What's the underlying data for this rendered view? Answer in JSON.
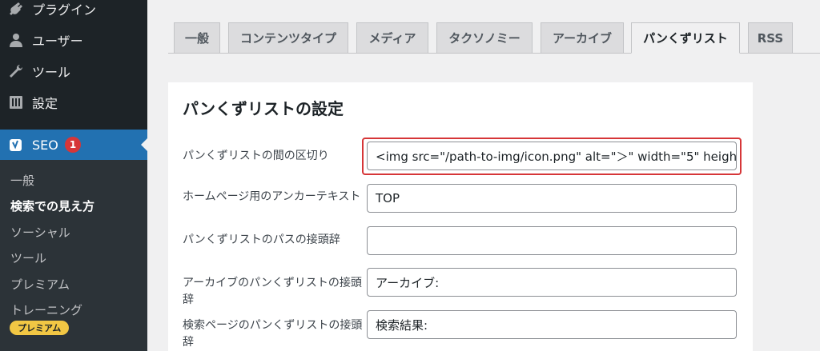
{
  "sidebar": {
    "menu": [
      {
        "label": "プラグイン",
        "icon": "plugin-icon"
      },
      {
        "label": "ユーザー",
        "icon": "user-icon"
      },
      {
        "label": "ツール",
        "icon": "wrench-icon"
      },
      {
        "label": "設定",
        "icon": "settings-icon"
      }
    ],
    "seo": {
      "label": "SEO",
      "icon": "yoast-icon",
      "badge": "1"
    },
    "submenu": [
      {
        "label": "一般"
      },
      {
        "label": "検索での見え方"
      },
      {
        "label": "ソーシャル"
      },
      {
        "label": "ツール"
      },
      {
        "label": "プレミアム"
      },
      {
        "label": "トレーニング"
      }
    ],
    "premium_pill": "プレミアム"
  },
  "tabs": [
    {
      "label": "一般"
    },
    {
      "label": "コンテンツタイプ"
    },
    {
      "label": "メディア"
    },
    {
      "label": "タクソノミー"
    },
    {
      "label": "アーカイブ"
    },
    {
      "label": "パンくずリスト"
    },
    {
      "label": "RSS"
    }
  ],
  "panel": {
    "title": "パンくずリストの設定",
    "fields": [
      {
        "label": "パンくずリストの間の区切り",
        "value": "<img src=\"/path-to-img/icon.png\" alt=\"＞\" width=\"5\" heigh"
      },
      {
        "label": "ホームページ用のアンカーテキスト",
        "value": "TOP"
      },
      {
        "label": "パンくずリストのパスの接頭辞",
        "value": ""
      },
      {
        "label": "アーカイブのパンくずリストの接頭辞",
        "value": "アーカイブ:"
      },
      {
        "label": "検索ページのパンくずリストの接頭辞",
        "value": "検索結果:"
      }
    ]
  },
  "colors": {
    "sidebar_bg": "#1d2327",
    "accent": "#2271b1",
    "highlight": "#d63638",
    "premium": "#f2c744"
  }
}
